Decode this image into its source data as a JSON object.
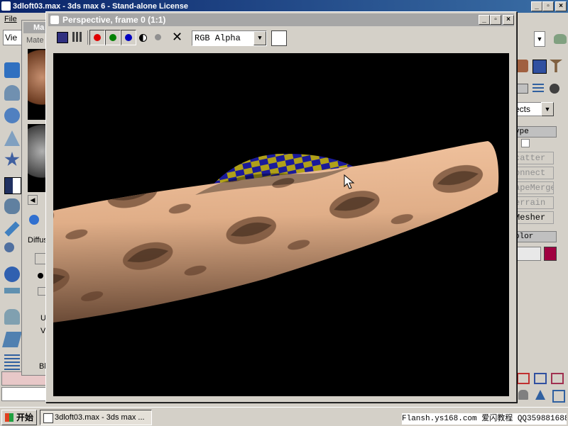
{
  "main_window": {
    "title": "3dloft03.max - 3ds max 6 - Stand-alone License"
  },
  "menu": {
    "file": "File"
  },
  "viewport_label": "Vie",
  "material_editor": {
    "title": "Ma",
    "tab": "Mate",
    "labels": {
      "diffuse": "Diffus",
      "u": "U",
      "v": "V",
      "bl": "Bl"
    }
  },
  "frame_window": {
    "title": "Perspective, frame 0 (1:1)",
    "channel_select": "RGB Alpha",
    "channels": {
      "red": "#e00000",
      "green": "#008000",
      "blue": "#0000c0"
    },
    "swatch_color": "#ffffff"
  },
  "right_panel": {
    "dropdown": "ects",
    "section_type": "ype",
    "buttons": [
      "catter",
      "onnect",
      "apeMerge",
      "errain",
      "Mesher"
    ],
    "section_color": "olor",
    "color_swatch": "#a00040"
  },
  "taskbar": {
    "start": "开始",
    "task": "3dloft03.max - 3ds max ...",
    "tray": "Flansh.ys168.com 爱闪教程 QQ359881688"
  }
}
